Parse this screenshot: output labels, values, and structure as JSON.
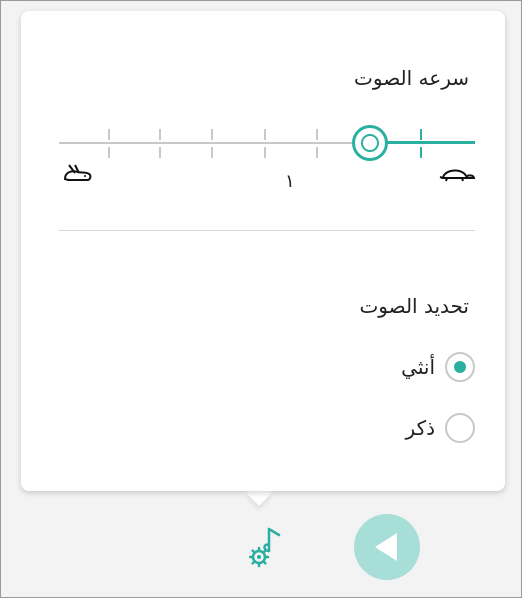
{
  "speed": {
    "title": "سرعه الصوت",
    "tick_label": "١",
    "slow_icon": "turtle-icon",
    "fast_icon": "hare-icon",
    "tick_count": 7,
    "value_index": 6
  },
  "voice": {
    "title": "تحديد الصوت",
    "options": [
      {
        "label": "أنثي",
        "selected": true
      },
      {
        "label": "ذكر",
        "selected": false
      }
    ]
  },
  "toolbar": {
    "settings_icon": "voice-settings-icon",
    "play_icon": "play-icon"
  },
  "colors": {
    "accent": "#2ab0a0",
    "accent_light": "#a7ded7",
    "track": "#c8c8c8"
  }
}
